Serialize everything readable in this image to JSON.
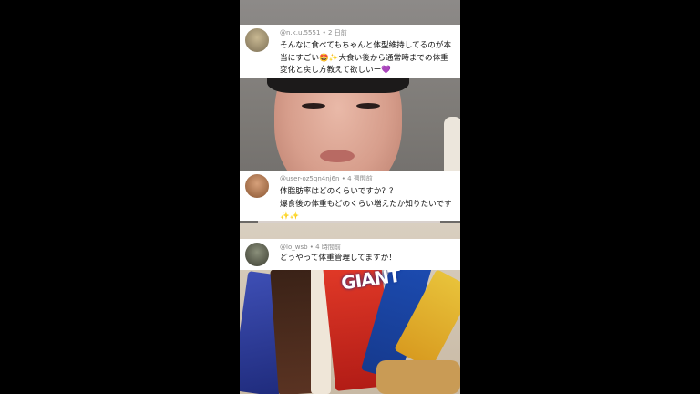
{
  "comments": [
    {
      "user": "@n.k.u.5551",
      "time": "2 日前",
      "text": "そんなに食べてもちゃんと体型維持してるのが本当にすごい🤩✨大食い後から通常時までの体重変化と戻し方教えて欲しいー💜"
    },
    {
      "user": "@user-oz5qn4nj6n",
      "time": "4 週間前",
      "text": "体脂肪率はどのくらいですか？？\n爆食後の体重もどのくらい増えたか知りたいです✨✨"
    },
    {
      "user": "@lo_wsb",
      "time": "4 時間前",
      "text": "どうやって体重管理してますか！"
    }
  ],
  "video": {
    "product_label": "GIANT"
  },
  "colors": {
    "background": "#000000",
    "comment_bg": "#ffffff",
    "meta_text": "#888888"
  }
}
